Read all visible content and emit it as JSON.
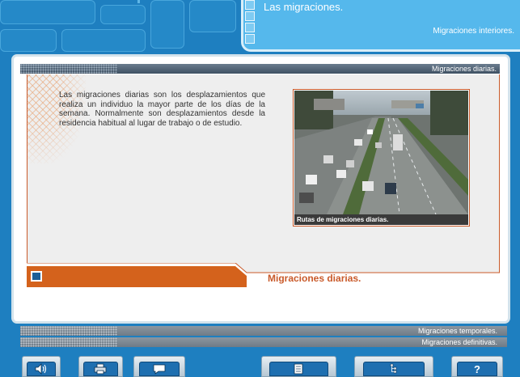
{
  "header": {
    "title": "Las migraciones.",
    "subtitle": "Migraciones interiores."
  },
  "section": {
    "bar_label": "Migraciones diarias.",
    "footer_title": "Migraciones diarias."
  },
  "content": {
    "paragraph": "Las migraciones diarias son los desplazamientos que realiza un individuo la mayor parte de los días de la semana. Normalmente son desplazamientos desde la residencia habitual al lugar de trabajo o de estudio.",
    "image_caption": "Rutas de migraciones diarias."
  },
  "nav": {
    "items": [
      {
        "label": "Migraciones temporales."
      },
      {
        "label": "Migraciones definitivas."
      }
    ]
  },
  "toolbar": {
    "buttons": [
      {
        "icon": "speaker-icon"
      },
      {
        "icon": "printer-icon"
      },
      {
        "icon": "speech-bubble-icon"
      },
      {
        "icon": "notebook-icon"
      },
      {
        "icon": "index-icon"
      },
      {
        "icon": "help-icon",
        "glyph": "?"
      }
    ]
  },
  "colors": {
    "accent_orange": "#c95a2a",
    "background_blue": "#1e7fc0",
    "header_blue": "#55b8ec"
  }
}
